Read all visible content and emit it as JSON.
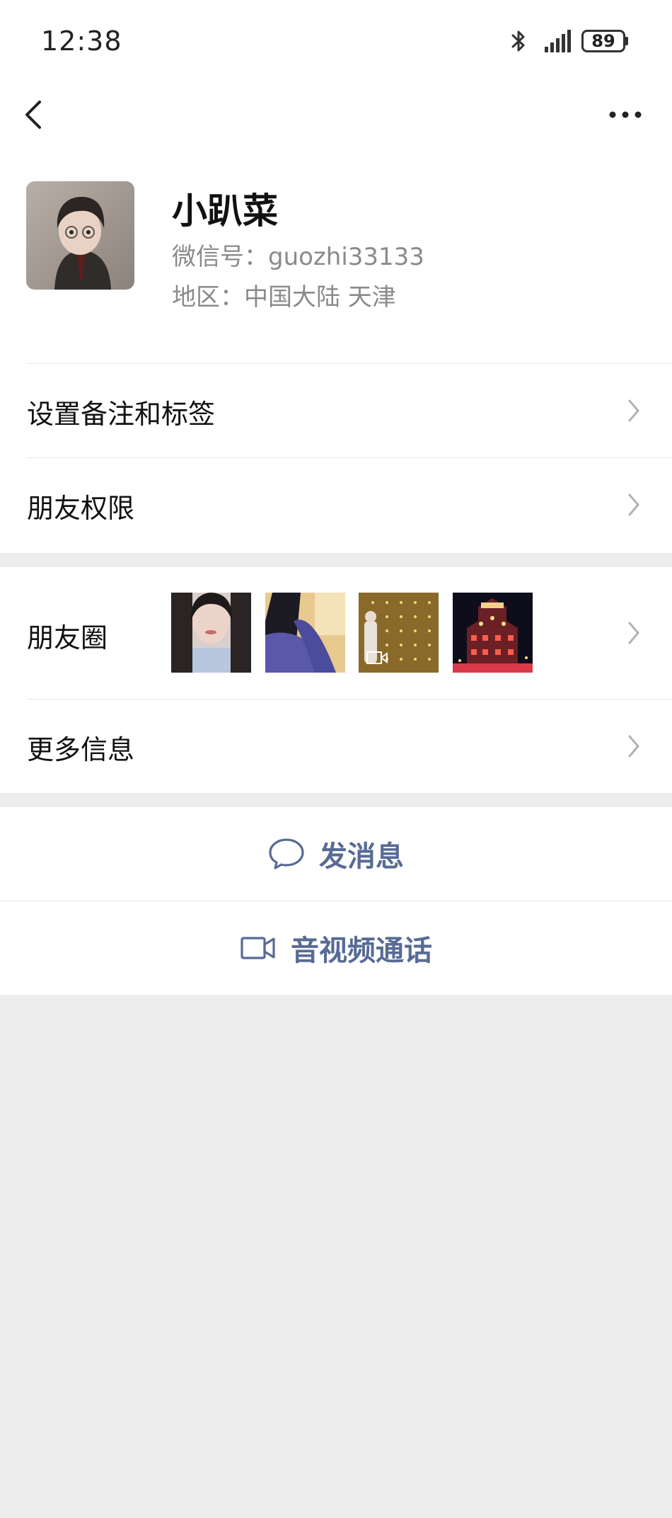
{
  "status_bar": {
    "time": "12:38",
    "battery": "89",
    "icons": [
      "bluetooth-icon",
      "signal-icon",
      "battery-icon"
    ]
  },
  "nav": {
    "back_icon": "chevron-left-icon",
    "more_icon": "more-dots-icon"
  },
  "profile": {
    "nickname": "小趴菜",
    "wechat_id": "微信号：guozhi33133",
    "region": "地区：中国大陆  天津"
  },
  "menu": {
    "remark_tags": "设置备注和标签",
    "friend_permissions": "朋友权限",
    "moments": "朋友圈",
    "more_info": "更多信息"
  },
  "actions": {
    "send_message": "发消息",
    "video_call": "音视频通话"
  },
  "colors": {
    "link_blue": "#576b95",
    "background_gray": "#ededed",
    "divider": "#e6e6e6"
  }
}
